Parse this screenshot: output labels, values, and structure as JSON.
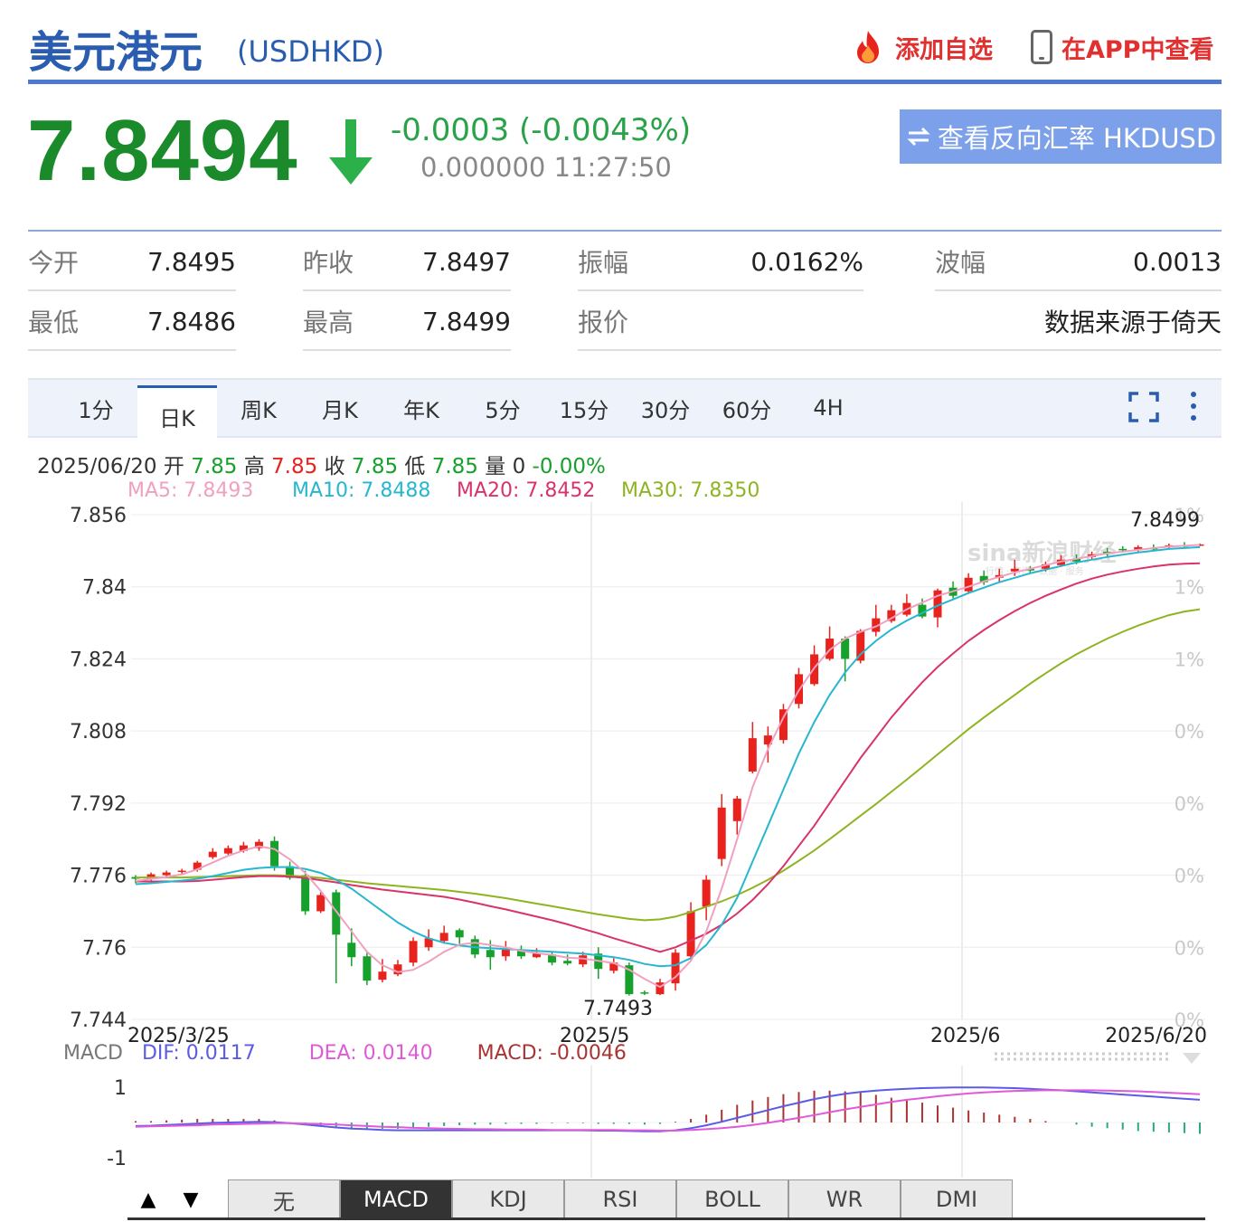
{
  "header": {
    "title": "美元港元",
    "symbol": "(USDHKD)",
    "add_watchlist": "添加自选",
    "view_in_app": "在APP中查看"
  },
  "quote": {
    "price": "7.8494",
    "change": "-0.0003 (-0.0043%)",
    "sub_info": "0.000000 11:27:50",
    "reverse_button": "查看反向汇率 HKDUSD",
    "price_color": "#1a8a2a"
  },
  "stats": {
    "open_label": "今开",
    "open": "7.8495",
    "prev_close_label": "昨收",
    "prev_close": "7.8497",
    "amplitude_label": "振幅",
    "amplitude": "0.0162%",
    "swing_label": "波幅",
    "swing": "0.0013",
    "low_label": "最低",
    "low": "7.8486",
    "high_label": "最高",
    "high": "7.8499",
    "quote_label": "报价",
    "source": "数据来源于倚天"
  },
  "tabs": [
    "1分",
    "日K",
    "周K",
    "月K",
    "年K",
    "5分",
    "15分",
    "30分",
    "60分",
    "4H"
  ],
  "active_tab": "日K",
  "bar_info": {
    "date": "2025/06/20",
    "open_label": "开",
    "open": "7.85",
    "high_label": "高",
    "high": "7.85",
    "close_label": "收",
    "close": "7.85",
    "low_label": "低",
    "low": "7.85",
    "vol_label": "量",
    "vol": "0",
    "pct": "-0.00%"
  },
  "ma_legend": {
    "ma5": "MA5: 7.8493",
    "ma10": "MA10: 7.8488",
    "ma20": "MA20: 7.8452",
    "ma30": "MA30: 7.8350"
  },
  "macd_legend": {
    "label": "MACD",
    "dif": "DIF: 0.0117",
    "dea": "DEA: 0.0140",
    "macd": "MACD: -0.0046"
  },
  "indicator_tabs": [
    "无",
    "MACD",
    "KDJ",
    "RSI",
    "BOLL",
    "WR",
    "DMI"
  ],
  "active_indicator": "MACD",
  "colors": {
    "up": "#e8231d",
    "down": "#16a02c",
    "ma5": "#f0a0c0",
    "ma10": "#26b7cf",
    "ma20": "#d9336a",
    "ma30": "#8fb421",
    "dif": "#5b5be8",
    "dea": "#e05ad8",
    "brand": "#2a5db0"
  },
  "chart_data": {
    "type": "candlestick",
    "x_ticks": [
      "2025/3/25",
      "2025/5",
      "2025/6",
      "2025/6/20"
    ],
    "y_ticks": [
      "7.856",
      "7.84",
      "7.824",
      "7.808",
      "7.792",
      "7.776",
      "7.76",
      "7.744"
    ],
    "right_ticks": [
      "1%",
      "1%",
      "1%",
      "0%",
      "0%",
      "0%",
      "0%",
      "0%"
    ],
    "ylim": [
      7.744,
      7.856
    ],
    "annotations": {
      "max_label": "7.8499",
      "min_label": "7.7493"
    },
    "candles": [
      {
        "o": 7.7756,
        "c": 7.7752,
        "h": 7.776,
        "l": 7.7742
      },
      {
        "o": 7.7752,
        "c": 7.7762,
        "h": 7.7766,
        "l": 7.7748
      },
      {
        "o": 7.776,
        "c": 7.7766,
        "h": 7.777,
        "l": 7.7756
      },
      {
        "o": 7.7768,
        "c": 7.777,
        "h": 7.7774,
        "l": 7.7762
      },
      {
        "o": 7.7772,
        "c": 7.7788,
        "h": 7.7792,
        "l": 7.7768
      },
      {
        "o": 7.78,
        "c": 7.7812,
        "h": 7.782,
        "l": 7.7796
      },
      {
        "o": 7.7808,
        "c": 7.782,
        "h": 7.7826,
        "l": 7.7804
      },
      {
        "o": 7.7814,
        "c": 7.7826,
        "h": 7.7834,
        "l": 7.781
      },
      {
        "o": 7.782,
        "c": 7.7834,
        "h": 7.784,
        "l": 7.7814
      },
      {
        "o": 7.7836,
        "c": 7.778,
        "h": 7.7846,
        "l": 7.777
      },
      {
        "o": 7.778,
        "c": 7.7754,
        "h": 7.779,
        "l": 7.775
      },
      {
        "o": 7.776,
        "c": 7.768,
        "h": 7.777,
        "l": 7.7672
      },
      {
        "o": 7.768,
        "c": 7.7716,
        "h": 7.7722,
        "l": 7.7676
      },
      {
        "o": 7.7722,
        "c": 7.7628,
        "h": 7.7728,
        "l": 7.752
      },
      {
        "o": 7.761,
        "c": 7.7578,
        "h": 7.7642,
        "l": 7.7558
      },
      {
        "o": 7.758,
        "c": 7.7526,
        "h": 7.7588,
        "l": 7.7516
      },
      {
        "o": 7.7528,
        "c": 7.7546,
        "h": 7.7574,
        "l": 7.7522
      },
      {
        "o": 7.754,
        "c": 7.7562,
        "h": 7.7572,
        "l": 7.7536
      },
      {
        "o": 7.7566,
        "c": 7.7614,
        "h": 7.7622,
        "l": 7.7558
      },
      {
        "o": 7.76,
        "c": 7.762,
        "h": 7.764,
        "l": 7.7592
      },
      {
        "o": 7.7614,
        "c": 7.7632,
        "h": 7.7648,
        "l": 7.7608
      },
      {
        "o": 7.7638,
        "c": 7.7622,
        "h": 7.7642,
        "l": 7.7606
      },
      {
        "o": 7.7618,
        "c": 7.7584,
        "h": 7.7626,
        "l": 7.7576
      },
      {
        "o": 7.7594,
        "c": 7.7578,
        "h": 7.7616,
        "l": 7.755
      },
      {
        "o": 7.758,
        "c": 7.7596,
        "h": 7.7614,
        "l": 7.757
      },
      {
        "o": 7.7592,
        "c": 7.758,
        "h": 7.7604,
        "l": 7.7574
      },
      {
        "o": 7.7578,
        "c": 7.7586,
        "h": 7.7598,
        "l": 7.7576
      },
      {
        "o": 7.7584,
        "c": 7.7566,
        "h": 7.759,
        "l": 7.756
      },
      {
        "o": 7.757,
        "c": 7.7564,
        "h": 7.7584,
        "l": 7.756
      },
      {
        "o": 7.7562,
        "c": 7.7582,
        "h": 7.759,
        "l": 7.7556
      },
      {
        "o": 7.7586,
        "c": 7.7552,
        "h": 7.76,
        "l": 7.753
      },
      {
        "o": 7.7548,
        "c": 7.7566,
        "h": 7.7576,
        "l": 7.7542
      },
      {
        "o": 7.756,
        "c": 7.7496,
        "h": 7.7566,
        "l": 7.7493
      },
      {
        "o": 7.75,
        "c": 7.7498,
        "h": 7.7504,
        "l": 7.7494
      },
      {
        "o": 7.7496,
        "c": 7.7522,
        "h": 7.753,
        "l": 7.7494
      },
      {
        "o": 7.752,
        "c": 7.7588,
        "h": 7.7596,
        "l": 7.7504
      },
      {
        "o": 7.758,
        "c": 7.768,
        "h": 7.77,
        "l": 7.7572
      },
      {
        "o": 7.769,
        "c": 7.775,
        "h": 7.776,
        "l": 7.766
      },
      {
        "o": 7.7796,
        "c": 7.791,
        "h": 7.794,
        "l": 7.778
      },
      {
        "o": 7.788,
        "c": 7.793,
        "h": 7.7936,
        "l": 7.785
      },
      {
        "o": 7.799,
        "c": 7.8064,
        "h": 7.81,
        "l": 7.7986
      },
      {
        "o": 7.805,
        "c": 7.807,
        "h": 7.809,
        "l": 7.801
      },
      {
        "o": 7.806,
        "c": 7.8128,
        "h": 7.814,
        "l": 7.8052
      },
      {
        "o": 7.814,
        "c": 7.8206,
        "h": 7.822,
        "l": 7.813
      },
      {
        "o": 7.8184,
        "c": 7.825,
        "h": 7.827,
        "l": 7.818
      },
      {
        "o": 7.824,
        "c": 7.8285,
        "h": 7.8312,
        "l": 7.8236
      },
      {
        "o": 7.8285,
        "c": 7.824,
        "h": 7.829,
        "l": 7.819
      },
      {
        "o": 7.8236,
        "c": 7.8302,
        "h": 7.8306,
        "l": 7.823
      },
      {
        "o": 7.83,
        "c": 7.833,
        "h": 7.836,
        "l": 7.829
      },
      {
        "o": 7.8324,
        "c": 7.8348,
        "h": 7.836,
        "l": 7.832
      },
      {
        "o": 7.8338,
        "c": 7.8364,
        "h": 7.8384,
        "l": 7.8334
      },
      {
        "o": 7.836,
        "c": 7.8334,
        "h": 7.8374,
        "l": 7.833
      },
      {
        "o": 7.8332,
        "c": 7.8392,
        "h": 7.8396,
        "l": 7.831
      },
      {
        "o": 7.8398,
        "c": 7.838,
        "h": 7.8412,
        "l": 7.8374
      },
      {
        "o": 7.839,
        "c": 7.842,
        "h": 7.843,
        "l": 7.8384
      },
      {
        "o": 7.8424,
        "c": 7.841,
        "h": 7.8436,
        "l": 7.8404
      },
      {
        "o": 7.842,
        "c": 7.8426,
        "h": 7.844,
        "l": 7.841
      },
      {
        "o": 7.8434,
        "c": 7.844,
        "h": 7.846,
        "l": 7.8424
      },
      {
        "o": 7.844,
        "c": 7.8436,
        "h": 7.8446,
        "l": 7.843
      },
      {
        "o": 7.844,
        "c": 7.845,
        "h": 7.8456,
        "l": 7.8434
      },
      {
        "o": 7.8448,
        "c": 7.846,
        "h": 7.847,
        "l": 7.8444
      },
      {
        "o": 7.8462,
        "c": 7.8456,
        "h": 7.8472,
        "l": 7.845
      },
      {
        "o": 7.8466,
        "c": 7.8472,
        "h": 7.8478,
        "l": 7.846
      },
      {
        "o": 7.8478,
        "c": 7.8474,
        "h": 7.8486,
        "l": 7.8468
      },
      {
        "o": 7.8484,
        "c": 7.8482,
        "h": 7.849,
        "l": 7.8476
      },
      {
        "o": 7.8482,
        "c": 7.8488,
        "h": 7.8492,
        "l": 7.8478
      },
      {
        "o": 7.8486,
        "c": 7.8484,
        "h": 7.8494,
        "l": 7.848
      },
      {
        "o": 7.8488,
        "c": 7.8492,
        "h": 7.8496,
        "l": 7.8484
      },
      {
        "o": 7.8492,
        "c": 7.849,
        "h": 7.8499,
        "l": 7.8486
      },
      {
        "o": 7.8493,
        "c": 7.8494,
        "h": 7.8496,
        "l": 7.849
      }
    ],
    "ma5": [
      7.7747,
      7.7752,
      7.7756,
      7.7762,
      7.7773,
      7.7788,
      7.7803,
      7.7815,
      7.7824,
      7.7818,
      7.7795,
      7.7765,
      7.7725,
      7.768,
      7.7635,
      7.759,
      7.756,
      7.7545,
      7.755,
      7.7568,
      7.759,
      7.7606,
      7.761,
      7.7605,
      7.76,
      7.7592,
      7.7587,
      7.7583,
      7.7577,
      7.7575,
      7.757,
      7.7565,
      7.755,
      7.753,
      7.7512,
      7.7534,
      7.757,
      7.7635,
      7.773,
      7.784,
      7.7955,
      7.804,
      7.811,
      7.817,
      7.822,
      7.826,
      7.8285,
      7.83,
      7.8312,
      7.833,
      7.835,
      7.8365,
      7.838,
      7.839,
      7.84,
      7.8412,
      7.8422,
      7.8432,
      7.844,
      7.8448,
      7.8456,
      7.8462,
      7.8468,
      7.8474,
      7.8478,
      7.8482,
      7.8486,
      7.8489,
      7.8491,
      7.8493
    ],
    "ma10": [
      7.774,
      7.7742,
      7.7745,
      7.7748,
      7.7752,
      7.7758,
      7.7765,
      7.7772,
      7.7776,
      7.7778,
      7.7778,
      7.7774,
      7.7765,
      7.775,
      7.773,
      7.7705,
      7.768,
      7.7655,
      7.7635,
      7.762,
      7.761,
      7.7604,
      7.76,
      7.7598,
      7.7596,
      7.7594,
      7.7592,
      7.759,
      7.7588,
      7.7586,
      7.7582,
      7.7578,
      7.7572,
      7.7563,
      7.7558,
      7.756,
      7.7576,
      7.7605,
      7.765,
      7.771,
      7.779,
      7.787,
      7.795,
      7.803,
      7.81,
      7.816,
      7.821,
      7.825,
      7.828,
      7.8305,
      7.8325,
      7.8342,
      7.8358,
      7.8372,
      7.8386,
      7.8398,
      7.841,
      7.842,
      7.843,
      7.8438,
      7.8446,
      7.8454,
      7.846,
      7.8466,
      7.8471,
      7.8476,
      7.848,
      7.8484,
      7.8486,
      7.8488
    ],
    "ma20": [
      7.7746,
      7.7746,
      7.7746,
      7.7746,
      7.7747,
      7.775,
      7.7753,
      7.7756,
      7.7758,
      7.7758,
      7.7757,
      7.7754,
      7.7749,
      7.7744,
      7.7738,
      7.7733,
      7.7728,
      7.7724,
      7.772,
      7.7716,
      7.7712,
      7.7706,
      7.7699,
      7.7691,
      7.7684,
      7.7676,
      7.7668,
      7.766,
      7.7651,
      7.7641,
      7.7631,
      7.762,
      7.761,
      7.76,
      7.759,
      7.76,
      7.7615,
      7.763,
      7.765,
      7.7675,
      7.7705,
      7.774,
      7.778,
      7.7825,
      7.787,
      7.792,
      7.797,
      7.802,
      7.8065,
      7.811,
      7.815,
      7.8188,
      7.8222,
      7.8252,
      7.828,
      7.8304,
      7.8326,
      7.8346,
      7.8364,
      7.838,
      7.8394,
      7.8407,
      7.8418,
      7.8427,
      7.8434,
      7.844,
      7.8445,
      7.8449,
      7.8451,
      7.8452
    ],
    "ma30": [
      7.7755,
      7.7755,
      7.7755,
      7.7755,
      7.7756,
      7.7757,
      7.7758,
      7.7759,
      7.776,
      7.776,
      7.7759,
      7.7757,
      7.7754,
      7.775,
      7.7746,
      7.7742,
      7.7739,
      7.7736,
      7.7733,
      7.773,
      7.7727,
      7.7723,
      7.7719,
      7.7714,
      7.7709,
      7.7703,
      7.7697,
      7.7691,
      7.7685,
      7.7679,
      7.7673,
      7.7668,
      7.7663,
      7.766,
      7.7662,
      7.7668,
      7.7678,
      7.769,
      7.7702,
      7.7716,
      7.7732,
      7.775,
      7.777,
      7.7792,
      7.7815,
      7.784,
      7.7866,
      7.7892,
      7.7918,
      7.7945,
      7.7972,
      7.8,
      7.8028,
      7.8056,
      7.8084,
      7.811,
      7.8135,
      7.816,
      7.8185,
      7.8208,
      7.823,
      7.825,
      7.8268,
      7.8285,
      7.83,
      7.8314,
      7.8326,
      7.8337,
      7.8345,
      7.835
    ],
    "macd_panel": {
      "ylim": [
        -1.2,
        1.2
      ],
      "y_ticks": [
        "1",
        "-1"
      ],
      "dif": [
        -0.1,
        -0.09,
        -0.07,
        -0.05,
        -0.03,
        -0.01,
        0.0,
        0.01,
        0.02,
        0.01,
        -0.02,
        -0.06,
        -0.1,
        -0.14,
        -0.17,
        -0.19,
        -0.21,
        -0.22,
        -0.22,
        -0.22,
        -0.22,
        -0.22,
        -0.22,
        -0.22,
        -0.22,
        -0.22,
        -0.22,
        -0.22,
        -0.22,
        -0.22,
        -0.23,
        -0.23,
        -0.24,
        -0.25,
        -0.25,
        -0.22,
        -0.16,
        -0.08,
        0.02,
        0.13,
        0.24,
        0.35,
        0.46,
        0.56,
        0.66,
        0.74,
        0.81,
        0.86,
        0.9,
        0.93,
        0.95,
        0.97,
        0.98,
        0.99,
        0.99,
        0.99,
        0.98,
        0.97,
        0.95,
        0.93,
        0.91,
        0.88,
        0.85,
        0.82,
        0.79,
        0.76,
        0.73,
        0.7,
        0.67,
        0.64
      ],
      "dea": [
        -0.12,
        -0.11,
        -0.1,
        -0.09,
        -0.08,
        -0.06,
        -0.05,
        -0.04,
        -0.03,
        -0.02,
        -0.02,
        -0.03,
        -0.04,
        -0.06,
        -0.08,
        -0.1,
        -0.12,
        -0.13,
        -0.15,
        -0.16,
        -0.17,
        -0.18,
        -0.19,
        -0.19,
        -0.2,
        -0.2,
        -0.2,
        -0.21,
        -0.21,
        -0.21,
        -0.21,
        -0.21,
        -0.22,
        -0.22,
        -0.23,
        -0.23,
        -0.21,
        -0.19,
        -0.16,
        -0.12,
        -0.07,
        -0.01,
        0.06,
        0.13,
        0.21,
        0.29,
        0.37,
        0.44,
        0.51,
        0.58,
        0.64,
        0.69,
        0.74,
        0.78,
        0.82,
        0.85,
        0.87,
        0.89,
        0.9,
        0.91,
        0.91,
        0.91,
        0.91,
        0.9,
        0.89,
        0.88,
        0.86,
        0.84,
        0.82,
        0.8
      ],
      "hist": [
        0.04,
        0.04,
        0.06,
        0.08,
        0.1,
        0.1,
        0.1,
        0.1,
        0.1,
        0.06,
        0.0,
        -0.06,
        -0.12,
        -0.16,
        -0.18,
        -0.18,
        -0.18,
        -0.18,
        -0.14,
        -0.12,
        -0.1,
        -0.08,
        -0.06,
        -0.06,
        -0.04,
        -0.04,
        -0.04,
        -0.02,
        -0.02,
        -0.02,
        -0.04,
        -0.04,
        -0.04,
        -0.06,
        -0.04,
        0.02,
        0.1,
        0.22,
        0.36,
        0.5,
        0.62,
        0.72,
        0.8,
        0.86,
        0.9,
        0.9,
        0.88,
        0.84,
        0.78,
        0.7,
        0.62,
        0.56,
        0.48,
        0.42,
        0.34,
        0.28,
        0.22,
        0.16,
        0.1,
        0.04,
        0.0,
        -0.06,
        -0.12,
        -0.16,
        -0.2,
        -0.24,
        -0.26,
        -0.28,
        -0.3,
        -0.32
      ]
    }
  }
}
